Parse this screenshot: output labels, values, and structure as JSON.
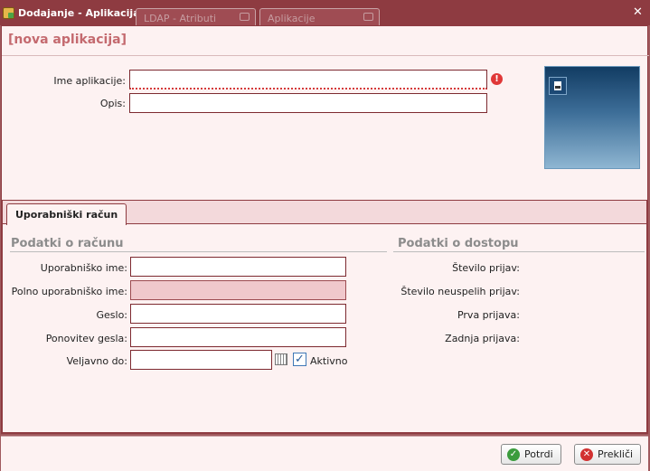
{
  "window": {
    "title": "Dodajanje - Aplikacija",
    "tabs": [
      "LDAP - Atributi",
      "Aplikacije"
    ],
    "close_glyph": "✕"
  },
  "form": {
    "heading": "[nova aplikacija]",
    "name_label": "Ime aplikacije:",
    "name_value": "",
    "name_error_glyph": "!",
    "desc_label": "Opis:",
    "desc_value": ""
  },
  "tab": {
    "label": "Uporabniški račun"
  },
  "account": {
    "section_title": "Podatki o računu",
    "username_label": "Uporabniško ime:",
    "full_username_label": "Polno uporabniško ime:",
    "password_label": "Geslo:",
    "password_repeat_label": "Ponovitev gesla:",
    "valid_until_label": "Veljavno do:",
    "active_label": "Aktivno",
    "active_checked": true
  },
  "access": {
    "section_title": "Podatki o dostopu",
    "login_count_label": "Število prijav:",
    "failed_login_count_label": "Število neuspelih prijav:",
    "first_login_label": "Prva prijava:",
    "last_login_label": "Zadnja prijava:"
  },
  "buttons": {
    "confirm": "Potrdi",
    "cancel": "Prekliči"
  },
  "colors": {
    "accent": "#8e3b41",
    "heading": "#c46a6f",
    "panel_bg": "#fdf2f2"
  }
}
